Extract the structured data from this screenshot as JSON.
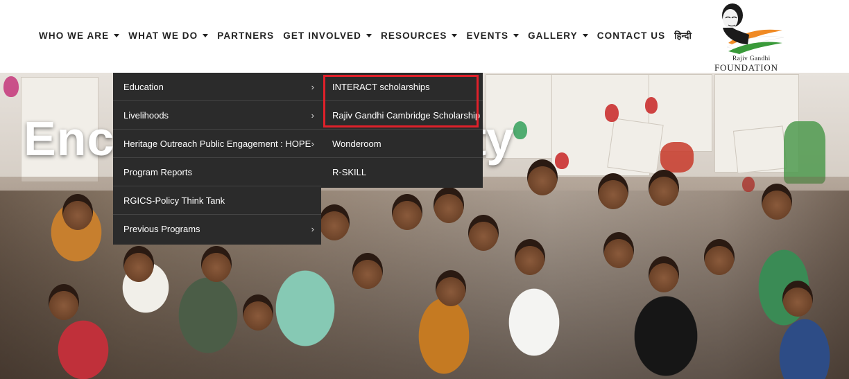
{
  "nav": {
    "items": [
      {
        "label": "WHO WE ARE",
        "has_dropdown": true
      },
      {
        "label": "WHAT WE DO",
        "has_dropdown": true
      },
      {
        "label": "PARTNERS",
        "has_dropdown": false
      },
      {
        "label": "GET INVOLVED",
        "has_dropdown": true
      },
      {
        "label": "RESOURCES",
        "has_dropdown": true
      },
      {
        "label": "EVENTS",
        "has_dropdown": true
      },
      {
        "label": "GALLERY",
        "has_dropdown": true
      },
      {
        "label": "CONTACT US",
        "has_dropdown": false
      },
      {
        "label": "हिन्दी",
        "has_dropdown": false
      }
    ]
  },
  "logo": {
    "line1": "Rajiv Gandhi",
    "line2": "FOUNDATION"
  },
  "hero": {
    "title_left": "Enco",
    "title_right": "ty"
  },
  "menu_what_we_do": {
    "items": [
      {
        "label": "Education",
        "has_submenu": true
      },
      {
        "label": "Livelihoods",
        "has_submenu": true
      },
      {
        "label": "Heritage Outreach Public Engagement : HOPE",
        "has_submenu": true
      },
      {
        "label": "Program Reports",
        "has_submenu": false
      },
      {
        "label": "RGICS-Policy Think Tank",
        "has_submenu": false
      },
      {
        "label": "Previous Programs",
        "has_submenu": true
      }
    ]
  },
  "menu_education": {
    "items": [
      {
        "label": "INTERACT scholarships"
      },
      {
        "label": "Rajiv Gandhi Cambridge Scholarship"
      },
      {
        "label": "Wonderoom"
      },
      {
        "label": "R-SKILL"
      }
    ]
  },
  "colors": {
    "menu_bg": "#2b2b2b",
    "highlight_border": "#e0202a",
    "nav_text": "#222222"
  }
}
